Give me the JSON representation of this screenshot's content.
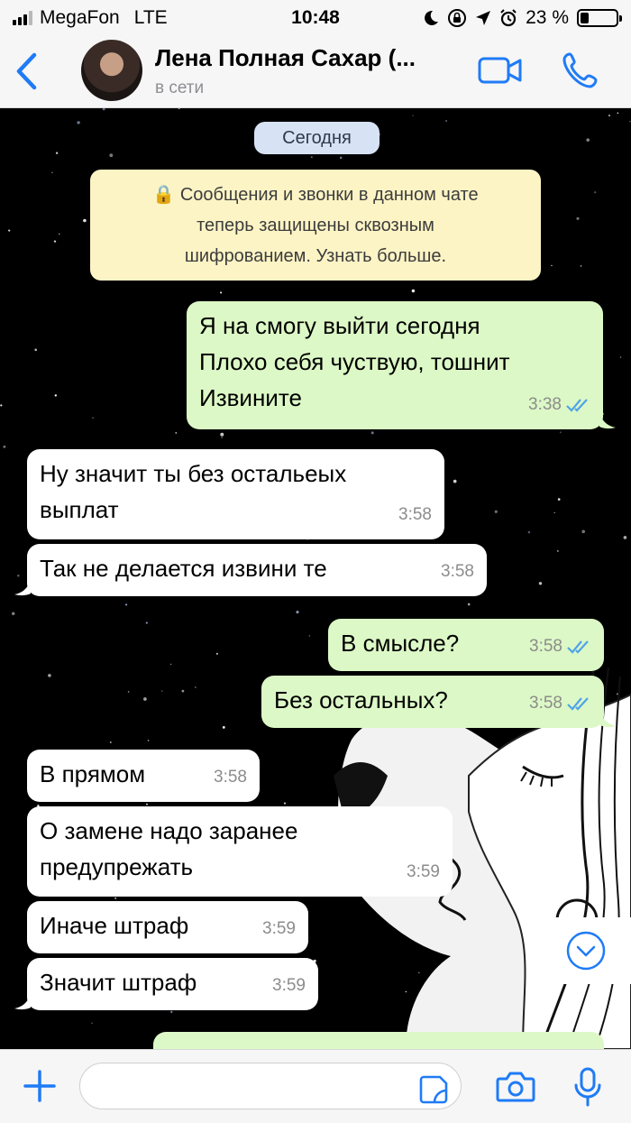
{
  "status_bar": {
    "carrier": "MegaFon",
    "network": "LTE",
    "time": "10:48",
    "battery": "23 %",
    "battery_level": 0.23
  },
  "header": {
    "contact_name": "Лена Полная Сахар (...",
    "contact_status": "в сети"
  },
  "chat": {
    "date_label": "Сегодня",
    "encryption_notice": "🔒 Сообщения и звонки в данном чате\nтеперь защищены сквозным\nшифрованием. Узнать больше.",
    "messages": [
      {
        "direction": "out",
        "text": "Я на смогу выйти сегодня\nПлохо себя чуствую, тошнит\nИзвините",
        "time": "3:38",
        "read": true
      },
      {
        "direction": "in",
        "text": "Ну значит ты без остальеых\nвыплат",
        "time": "3:58"
      },
      {
        "direction": "in",
        "text": "Так не делается извини те",
        "time": "3:58"
      },
      {
        "direction": "out",
        "text": "В смысле?",
        "time": "3:58",
        "read": true
      },
      {
        "direction": "out",
        "text": "Без остальных?",
        "time": "3:58",
        "read": true
      },
      {
        "direction": "in",
        "text": "В прямом",
        "time": "3:58"
      },
      {
        "direction": "in",
        "text": "О замене надо заранее\nпредупрежать",
        "time": "3:59"
      },
      {
        "direction": "in",
        "text": "Иначе штраф",
        "time": "3:59"
      },
      {
        "direction": "in",
        "text": "Значит штраф",
        "time": "3:59"
      }
    ]
  },
  "colors": {
    "accent": "#1f7bf6",
    "incoming_bubble": "#ffffff",
    "outgoing_bubble": "#dcf8c6",
    "read_ticks": "#4fa3e8",
    "date_pill": "#d7e3f5",
    "notice": "#fdf4c5"
  },
  "icons": {
    "back": "chevron-left-icon",
    "video_call": "video-camera-icon",
    "voice_call": "phone-icon",
    "scroll_down": "chevron-down-circle-icon",
    "attach": "plus-icon",
    "sticker": "sticker-icon",
    "camera": "camera-icon",
    "microphone": "microphone-icon"
  }
}
